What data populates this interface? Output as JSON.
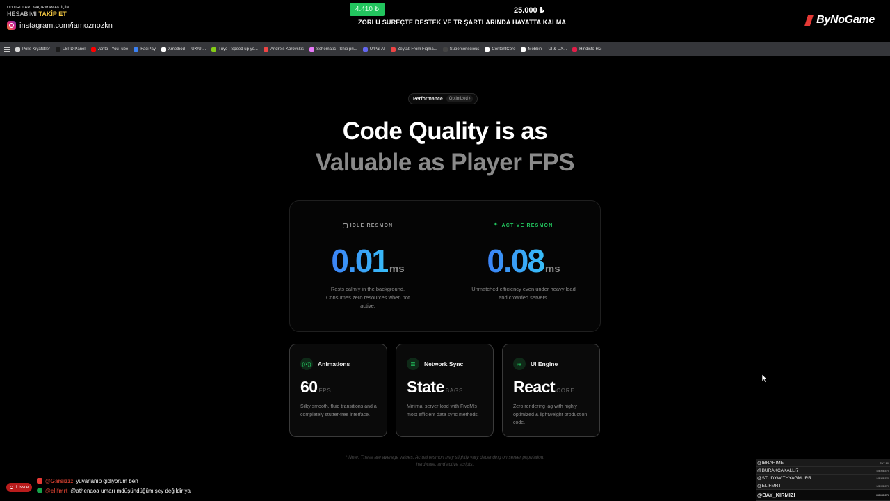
{
  "overlay": {
    "ig_small": "DIYURULARI KAÇIRMAMAK İÇİN",
    "ig_follow_prefix": "HESABIMI",
    "ig_follow_strong": "TAKİP ET",
    "ig_handle": "instagram.com/iamoznozkn",
    "donation_current": "4.410 ₺",
    "donation_goal": "25.000 ₺",
    "donation_title": "ZORLU SÜREÇTE DESTEK VE TR ŞARTLARINDA HAYATTA KALMA",
    "brand": "ByNoGame"
  },
  "bookmarks": [
    {
      "label": "Polis Kıyafetler",
      "color": "#d9d9d9"
    },
    {
      "label": "LSPD Panel",
      "color": "#1a1a1a"
    },
    {
      "label": "Janto - YouTube",
      "color": "#ff0000"
    },
    {
      "label": "FaciPay",
      "color": "#3b82f6"
    },
    {
      "label": "Xmethod — UX/UI...",
      "color": "#ffffff"
    },
    {
      "label": "Tuyo | Speed up yo...",
      "color": "#84cc16"
    },
    {
      "label": "Andrejs Korovskis",
      "color": "#ef4444"
    },
    {
      "label": "Schematic - Ship pri...",
      "color": "#e879f9"
    },
    {
      "label": "UrPal AI",
      "color": "#6366f1"
    },
    {
      "label": "Zeytal: From Figma...",
      "color": "#ef4444"
    },
    {
      "label": "Superconscious",
      "color": "#444444"
    },
    {
      "label": "ContentCore",
      "color": "#ffffff"
    },
    {
      "label": "Mobbin — UI & UX...",
      "color": "#ffffff"
    },
    {
      "label": "Hindisto HG",
      "color": "#e11d48"
    }
  ],
  "badge": {
    "label": "Performance",
    "sub": "Optimized"
  },
  "heading": {
    "line1": "Code Quality is as",
    "line2": "Valuable as Player FPS"
  },
  "resmon": {
    "idle": {
      "label": "IDLE RESMON",
      "value": "0.01",
      "unit": "ms",
      "desc": "Rests calmly in the background. Consumes zero resources when not active."
    },
    "active": {
      "label": "ACTIVE RESMON",
      "value": "0.08",
      "unit": "ms",
      "desc": "Unmatched efficiency even under heavy load and crowded servers."
    }
  },
  "features": [
    {
      "title": "Animations",
      "value": "60",
      "unit": "FPS",
      "desc": "Silky smooth, fluid transitions and a completely stutter-free interface.",
      "icon": "radio-icon"
    },
    {
      "title": "Network Sync",
      "value": "State",
      "unit": "BAGS",
      "desc": "Minimal server load with FiveM's most efficient data sync methods.",
      "icon": "server-icon"
    },
    {
      "title": "UI Engine",
      "value": "React",
      "unit": "CORE",
      "desc": "Zero rendering lag with highly optimized & lightweight production code.",
      "icon": "layers-icon"
    }
  ],
  "note": "* Note: These are average values. Actual resmon may slightly vary depending on server population, hardware, and active scripts.",
  "chat": [
    {
      "user": "@Garsizzz",
      "text": "yuvarlanıp gidiyorum ben"
    },
    {
      "user": "@elifmrt",
      "text": "@athenaoa umarı mdüşündüğüm şey değildir ya"
    }
  ],
  "issue_badge": "1 Issue",
  "members": [
    {
      "name": "@IBRAHIME",
      "tag": "TAY 10"
    },
    {
      "name": "@BURAKCAKALLI7",
      "tag": "MEMBER"
    },
    {
      "name": "@STUDYWITHYAGMURR",
      "tag": "MEMBER"
    },
    {
      "name": "@ELIFMRT",
      "tag": "MEMBER"
    },
    {
      "name": "@BAY_KIRMIZI",
      "tag": "MEMBER"
    }
  ],
  "colors": {
    "accent_green": "#22c55e",
    "accent_blue": "#3b82f6",
    "background": "#000000"
  }
}
